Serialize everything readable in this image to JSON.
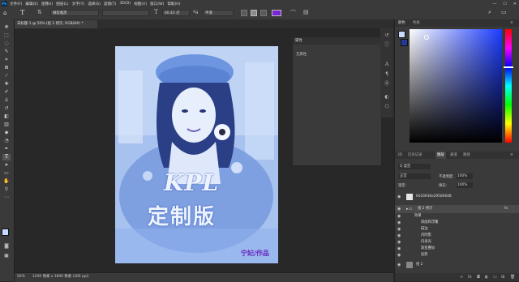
{
  "menu": {
    "logo": "Ps",
    "items": [
      "文件(F)",
      "编辑(E)",
      "图像(I)",
      "图层(L)",
      "文字(Y)",
      "选择(S)",
      "滤镜(T)",
      "3D(D)",
      "视图(V)",
      "窗口(W)",
      "帮助(H)"
    ],
    "window_controls": [
      "—",
      "☐",
      "✕"
    ]
  },
  "options": {
    "font_family": "微软雅黑",
    "font_style": "",
    "font_size": "60.43 点",
    "anti_alias": "平滑"
  },
  "document": {
    "tab_title": "未标题-1 @ 50% (组 2 拷贝, RGB/8#) *",
    "zoom": "50%",
    "size_info": "1200 像素 x 1600 像素 (300 ppi)"
  },
  "artwork": {
    "title_line1": "KPL",
    "title_line2": "定制版",
    "credit": "宁妃/作品"
  },
  "properties": {
    "tab": "属性",
    "text": "无属性"
  },
  "color_panel": {
    "tabs": [
      "颜色",
      "色板"
    ],
    "fg_color": "#c7daff",
    "bg_color": "#23399a",
    "field_hue": "#1c3cff"
  },
  "layers_panel": {
    "tabs": [
      "图层",
      "通道",
      "路径",
      "历史记录",
      "3D"
    ],
    "filter_label": "Q 类型",
    "blend_mode": "正常",
    "opacity_label": "不透明度:",
    "opacity_value": "100%",
    "lock_label": "锁定:",
    "fill_label": "填充:",
    "fill_value": "100%",
    "rows": [
      {
        "name": "6d16936e29580648",
        "indent": 0,
        "thumb": true
      },
      {
        "name": "组 2 拷贝",
        "indent": 0,
        "thumb": false
      },
      {
        "name": "效果",
        "indent": 1,
        "thumb": false
      },
      {
        "name": "斜面和浮雕",
        "indent": 2,
        "thumb": false
      },
      {
        "name": "描边",
        "indent": 2,
        "thumb": false
      },
      {
        "name": "内阴影",
        "indent": 2,
        "thumb": false
      },
      {
        "name": "内发光",
        "indent": 2,
        "thumb": false
      },
      {
        "name": "渐变叠加",
        "indent": 2,
        "thumb": false
      },
      {
        "name": "投影",
        "indent": 2,
        "thumb": false
      },
      {
        "name": "组 2",
        "indent": 0,
        "thumb": false
      }
    ]
  }
}
